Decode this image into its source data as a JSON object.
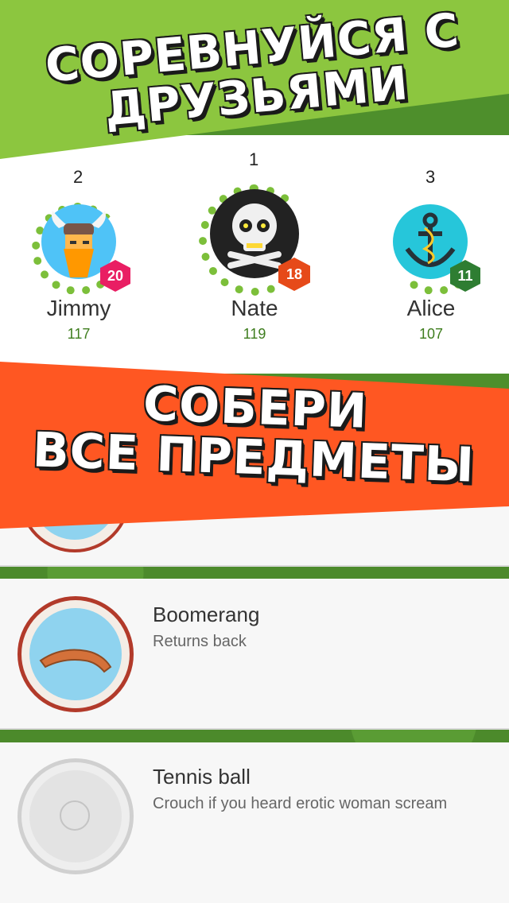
{
  "banners": {
    "top_line1": "Соревнуйся с",
    "top_line2": "друзьями",
    "mid_line1": "Собери",
    "mid_line2": "все предметы"
  },
  "leaderboard": [
    {
      "rank": "2",
      "name": "Jimmy",
      "score": "117",
      "level": "20",
      "avatar": "viking-icon",
      "badge_color": "#e91e63",
      "avatar_bg": "#4fc3f7"
    },
    {
      "rank": "1",
      "name": "Nate",
      "score": "119",
      "level": "18",
      "avatar": "skull-icon",
      "badge_color": "#e64a19",
      "avatar_bg": "#222222"
    },
    {
      "rank": "3",
      "name": "Alice",
      "score": "107",
      "level": "11",
      "avatar": "anchor-icon",
      "badge_color": "#2e7d32",
      "avatar_bg": "#26c6da"
    }
  ],
  "items": [
    {
      "name": "Boomerang",
      "description": "Returns back",
      "icon": "boomerang-icon"
    },
    {
      "name": "Tennis ball",
      "description": "Crouch if you heard erotic woman scream",
      "icon": "tennis-ball-icon"
    }
  ]
}
